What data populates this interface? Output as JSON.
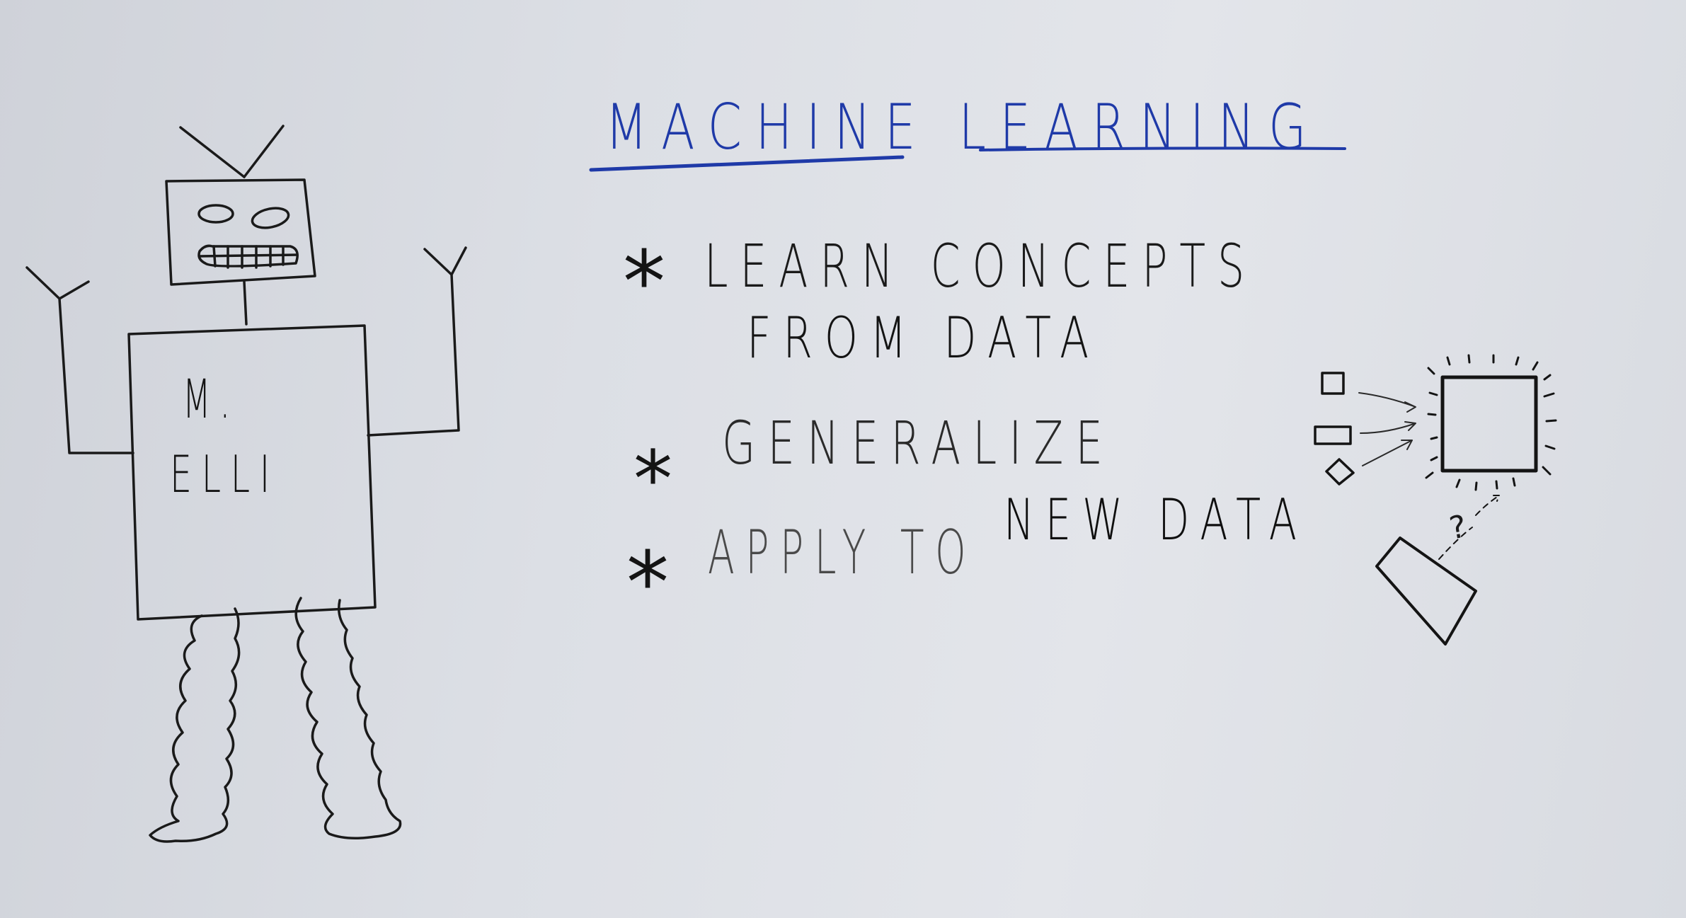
{
  "title": "MACHINE LEARNING",
  "title_color": "#1f3aa8",
  "ink_color": "#141414",
  "robot": {
    "shirt_line1": "M.",
    "shirt_line2": "ELLI"
  },
  "bullets": [
    {
      "marker": "*",
      "line1": "LEARN CONCEPTS",
      "line2": "FROM DATA"
    },
    {
      "marker": "*",
      "line1": "GENERALIZE"
    },
    {
      "marker": "*",
      "line1_faint": "APPLY TO",
      "line1_bold": "NEW DATA"
    }
  ],
  "diagram": {
    "question_mark": "?"
  }
}
